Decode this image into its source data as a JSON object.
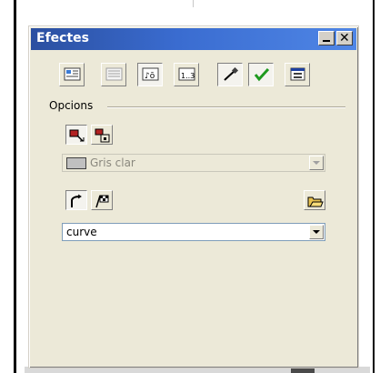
{
  "window": {
    "title": "Efectes"
  },
  "titlebar_buttons": {
    "minimize_icon": "minimize-icon",
    "close_icon": "close-icon"
  },
  "toolbar": {
    "icons": [
      "paragraph-panel-icon",
      "text-panel-icon",
      "sound-effects-icon",
      "numbering-icon",
      "pen-icon",
      "checkmark-icon",
      "window-panel-icon"
    ]
  },
  "options": {
    "group_label": "Opcions",
    "buttons": [
      "effect-enter-icon",
      "effect-exit-icon"
    ],
    "color_select": {
      "value": "Gris clar",
      "swatch_color": "#c0c0c0",
      "disabled": true
    }
  },
  "path": {
    "buttons": [
      "curve-path-icon",
      "custom-path-icon"
    ],
    "open_icon": "open-folder-icon",
    "select": {
      "value": "curve"
    }
  },
  "colors": {
    "titlebar": "#3a6cd0",
    "window_bg": "#ece9d8"
  }
}
